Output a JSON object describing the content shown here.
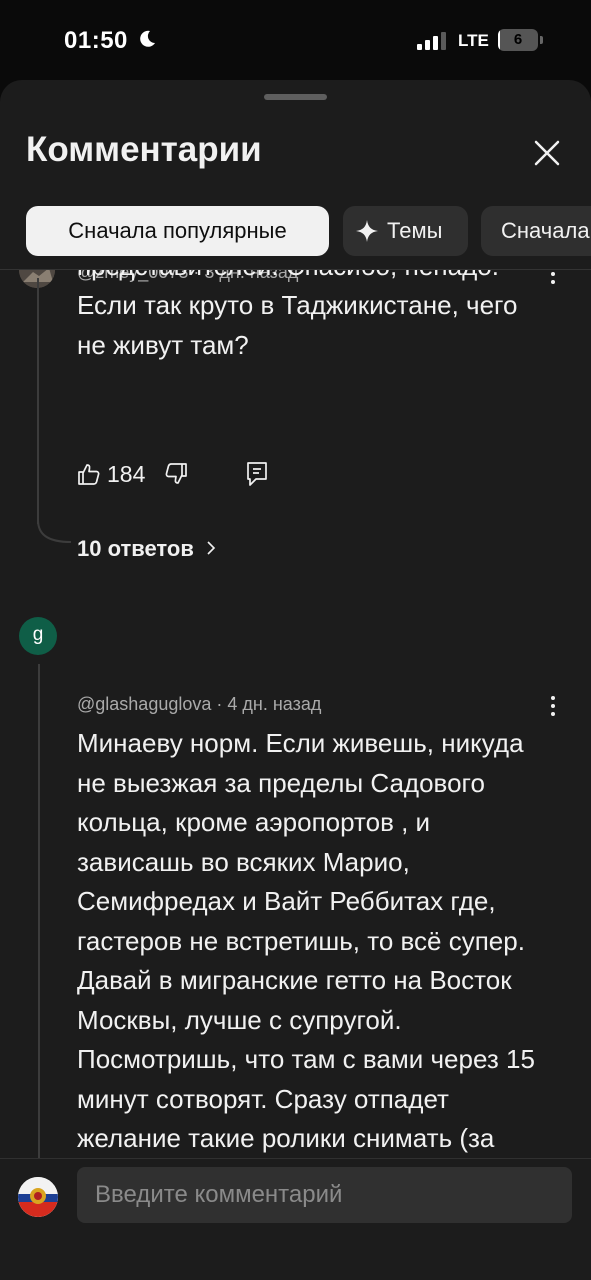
{
  "status_bar": {
    "time": "01:50",
    "network": "LTE",
    "battery_percent": "6"
  },
  "sheet": {
    "title": "Комментарии",
    "close_icon": "close-icon"
  },
  "filters": {
    "popular": "Сначала популярные",
    "topics": "Темы",
    "newest_partial": "Сначала новые"
  },
  "comments": [
    {
      "author_partial": "@zmey_0073",
      "age": "3 дн. назад",
      "text": "Спустился в метро, увидел этих представителей. Спасибо, ненадо. Если так круто в Таджикистане, чего не живут там?",
      "likes": "184",
      "replies_label": "10 ответов"
    },
    {
      "avatar_letter": "g",
      "author": "@glashaguglova",
      "age": "4 дн. назад",
      "text": "Минаеву норм. Если живешь, никуда не выезжая за пределы Садового кольца, кроме аэропортов , и зависашь во всяких Марио, Семифредах и Вайт Реббитах где, гастеров  не встретишь, то всё супер. Давай в мигранские гетто на Восток Москвы, лучше с супругой. Посмотришь, что там с вами через 15 минут сотворят. Сразу отпадет желание такие ролики снимать (за любые деньги)."
    }
  ],
  "composer": {
    "placeholder": "Введите комментарий"
  },
  "colors": {
    "sheet_bg": "#1c1c1c",
    "chip_active_bg": "#f1f1f1",
    "chip_bg": "#2f2f2f",
    "avatar_g": "#0f5e47",
    "meta_text": "#aaaaaa"
  }
}
